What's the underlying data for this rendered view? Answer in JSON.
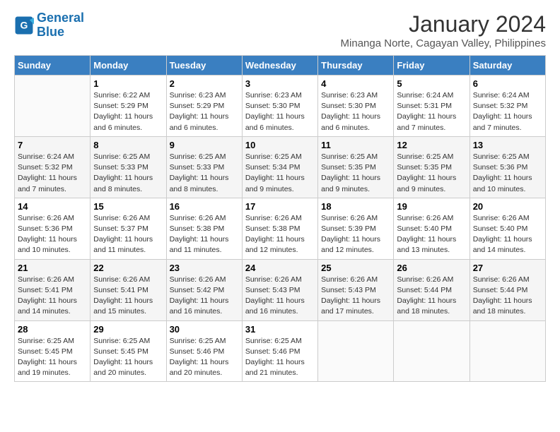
{
  "logo": {
    "line1": "General",
    "line2": "Blue"
  },
  "title": "January 2024",
  "subtitle": "Minanga Norte, Cagayan Valley, Philippines",
  "headers": [
    "Sunday",
    "Monday",
    "Tuesday",
    "Wednesday",
    "Thursday",
    "Friday",
    "Saturday"
  ],
  "weeks": [
    [
      {
        "day": "",
        "sunrise": "",
        "sunset": "",
        "daylight": ""
      },
      {
        "day": "1",
        "sunrise": "6:22 AM",
        "sunset": "5:29 PM",
        "daylight": "11 hours and 6 minutes."
      },
      {
        "day": "2",
        "sunrise": "6:23 AM",
        "sunset": "5:29 PM",
        "daylight": "11 hours and 6 minutes."
      },
      {
        "day": "3",
        "sunrise": "6:23 AM",
        "sunset": "5:30 PM",
        "daylight": "11 hours and 6 minutes."
      },
      {
        "day": "4",
        "sunrise": "6:23 AM",
        "sunset": "5:30 PM",
        "daylight": "11 hours and 6 minutes."
      },
      {
        "day": "5",
        "sunrise": "6:24 AM",
        "sunset": "5:31 PM",
        "daylight": "11 hours and 7 minutes."
      },
      {
        "day": "6",
        "sunrise": "6:24 AM",
        "sunset": "5:32 PM",
        "daylight": "11 hours and 7 minutes."
      }
    ],
    [
      {
        "day": "7",
        "sunrise": "6:24 AM",
        "sunset": "5:32 PM",
        "daylight": "11 hours and 7 minutes."
      },
      {
        "day": "8",
        "sunrise": "6:25 AM",
        "sunset": "5:33 PM",
        "daylight": "11 hours and 8 minutes."
      },
      {
        "day": "9",
        "sunrise": "6:25 AM",
        "sunset": "5:33 PM",
        "daylight": "11 hours and 8 minutes."
      },
      {
        "day": "10",
        "sunrise": "6:25 AM",
        "sunset": "5:34 PM",
        "daylight": "11 hours and 9 minutes."
      },
      {
        "day": "11",
        "sunrise": "6:25 AM",
        "sunset": "5:35 PM",
        "daylight": "11 hours and 9 minutes."
      },
      {
        "day": "12",
        "sunrise": "6:25 AM",
        "sunset": "5:35 PM",
        "daylight": "11 hours and 9 minutes."
      },
      {
        "day": "13",
        "sunrise": "6:25 AM",
        "sunset": "5:36 PM",
        "daylight": "11 hours and 10 minutes."
      }
    ],
    [
      {
        "day": "14",
        "sunrise": "6:26 AM",
        "sunset": "5:36 PM",
        "daylight": "11 hours and 10 minutes."
      },
      {
        "day": "15",
        "sunrise": "6:26 AM",
        "sunset": "5:37 PM",
        "daylight": "11 hours and 11 minutes."
      },
      {
        "day": "16",
        "sunrise": "6:26 AM",
        "sunset": "5:38 PM",
        "daylight": "11 hours and 11 minutes."
      },
      {
        "day": "17",
        "sunrise": "6:26 AM",
        "sunset": "5:38 PM",
        "daylight": "11 hours and 12 minutes."
      },
      {
        "day": "18",
        "sunrise": "6:26 AM",
        "sunset": "5:39 PM",
        "daylight": "11 hours and 12 minutes."
      },
      {
        "day": "19",
        "sunrise": "6:26 AM",
        "sunset": "5:40 PM",
        "daylight": "11 hours and 13 minutes."
      },
      {
        "day": "20",
        "sunrise": "6:26 AM",
        "sunset": "5:40 PM",
        "daylight": "11 hours and 14 minutes."
      }
    ],
    [
      {
        "day": "21",
        "sunrise": "6:26 AM",
        "sunset": "5:41 PM",
        "daylight": "11 hours and 14 minutes."
      },
      {
        "day": "22",
        "sunrise": "6:26 AM",
        "sunset": "5:41 PM",
        "daylight": "11 hours and 15 minutes."
      },
      {
        "day": "23",
        "sunrise": "6:26 AM",
        "sunset": "5:42 PM",
        "daylight": "11 hours and 16 minutes."
      },
      {
        "day": "24",
        "sunrise": "6:26 AM",
        "sunset": "5:43 PM",
        "daylight": "11 hours and 16 minutes."
      },
      {
        "day": "25",
        "sunrise": "6:26 AM",
        "sunset": "5:43 PM",
        "daylight": "11 hours and 17 minutes."
      },
      {
        "day": "26",
        "sunrise": "6:26 AM",
        "sunset": "5:44 PM",
        "daylight": "11 hours and 18 minutes."
      },
      {
        "day": "27",
        "sunrise": "6:26 AM",
        "sunset": "5:44 PM",
        "daylight": "11 hours and 18 minutes."
      }
    ],
    [
      {
        "day": "28",
        "sunrise": "6:25 AM",
        "sunset": "5:45 PM",
        "daylight": "11 hours and 19 minutes."
      },
      {
        "day": "29",
        "sunrise": "6:25 AM",
        "sunset": "5:45 PM",
        "daylight": "11 hours and 20 minutes."
      },
      {
        "day": "30",
        "sunrise": "6:25 AM",
        "sunset": "5:46 PM",
        "daylight": "11 hours and 20 minutes."
      },
      {
        "day": "31",
        "sunrise": "6:25 AM",
        "sunset": "5:46 PM",
        "daylight": "11 hours and 21 minutes."
      },
      {
        "day": "",
        "sunrise": "",
        "sunset": "",
        "daylight": ""
      },
      {
        "day": "",
        "sunrise": "",
        "sunset": "",
        "daylight": ""
      },
      {
        "day": "",
        "sunrise": "",
        "sunset": "",
        "daylight": ""
      }
    ]
  ],
  "labels": {
    "sunrise_prefix": "Sunrise: ",
    "sunset_prefix": "Sunset: ",
    "daylight_prefix": "Daylight: "
  }
}
